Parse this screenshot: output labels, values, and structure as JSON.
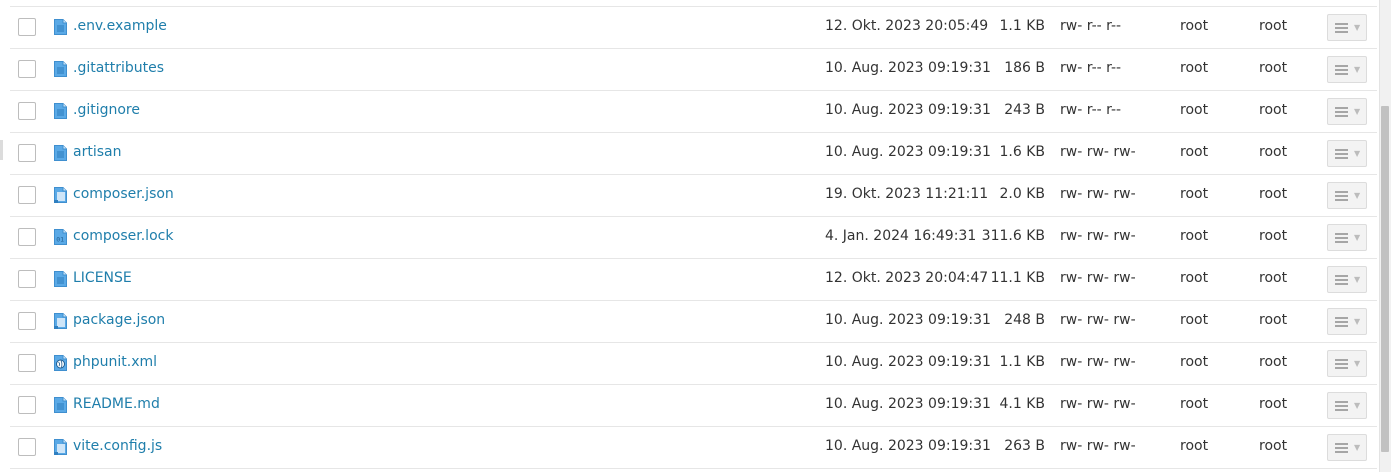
{
  "files": [
    {
      "name": ".env.example",
      "icon": "text-file-icon",
      "date": "12. Okt. 2023 20:05:49",
      "size": "1.1 KB",
      "perms": "rw- r-- r--",
      "owner": "root",
      "group": "root"
    },
    {
      "name": ".gitattributes",
      "icon": "text-file-icon",
      "date": "10. Aug. 2023 09:19:31",
      "size": "186 B",
      "perms": "rw- r-- r--",
      "owner": "root",
      "group": "root"
    },
    {
      "name": ".gitignore",
      "icon": "text-file-icon",
      "date": "10. Aug. 2023 09:19:31",
      "size": "243 B",
      "perms": "rw- r-- r--",
      "owner": "root",
      "group": "root"
    },
    {
      "name": "artisan",
      "icon": "text-file-icon",
      "date": "10. Aug. 2023 09:19:31",
      "size": "1.6 KB",
      "perms": "rw- rw- rw-",
      "owner": "root",
      "group": "root"
    },
    {
      "name": "composer.json",
      "icon": "code-file-icon",
      "date": "19. Okt. 2023 11:21:11",
      "size": "2.0 KB",
      "perms": "rw- rw- rw-",
      "owner": "root",
      "group": "root"
    },
    {
      "name": "composer.lock",
      "icon": "binary-file-icon",
      "date": "4. Jan. 2024 16:49:31",
      "size": "311.6 KB",
      "perms": "rw- rw- rw-",
      "owner": "root",
      "group": "root"
    },
    {
      "name": "LICENSE",
      "icon": "text-file-icon",
      "date": "12. Okt. 2023 20:04:47",
      "size": "11.1 KB",
      "perms": "rw- rw- rw-",
      "owner": "root",
      "group": "root"
    },
    {
      "name": "package.json",
      "icon": "code-file-icon",
      "date": "10. Aug. 2023 09:19:31",
      "size": "248 B",
      "perms": "rw- rw- rw-",
      "owner": "root",
      "group": "root"
    },
    {
      "name": "phpunit.xml",
      "icon": "web-file-icon",
      "date": "10. Aug. 2023 09:19:31",
      "size": "1.1 KB",
      "perms": "rw- rw- rw-",
      "owner": "root",
      "group": "root"
    },
    {
      "name": "README.md",
      "icon": "text-file-icon",
      "date": "10. Aug. 2023 09:19:31",
      "size": "4.1 KB",
      "perms": "rw- rw- rw-",
      "owner": "root",
      "group": "root"
    },
    {
      "name": "vite.config.js",
      "icon": "code-file-icon",
      "date": "10. Aug. 2023 09:19:31",
      "size": "263 B",
      "perms": "rw- rw- rw-",
      "owner": "root",
      "group": "root"
    }
  ],
  "colors": {
    "link": "#1f7eab",
    "icon_blue": "#5aa9e6",
    "border": "#e6e6e6"
  }
}
